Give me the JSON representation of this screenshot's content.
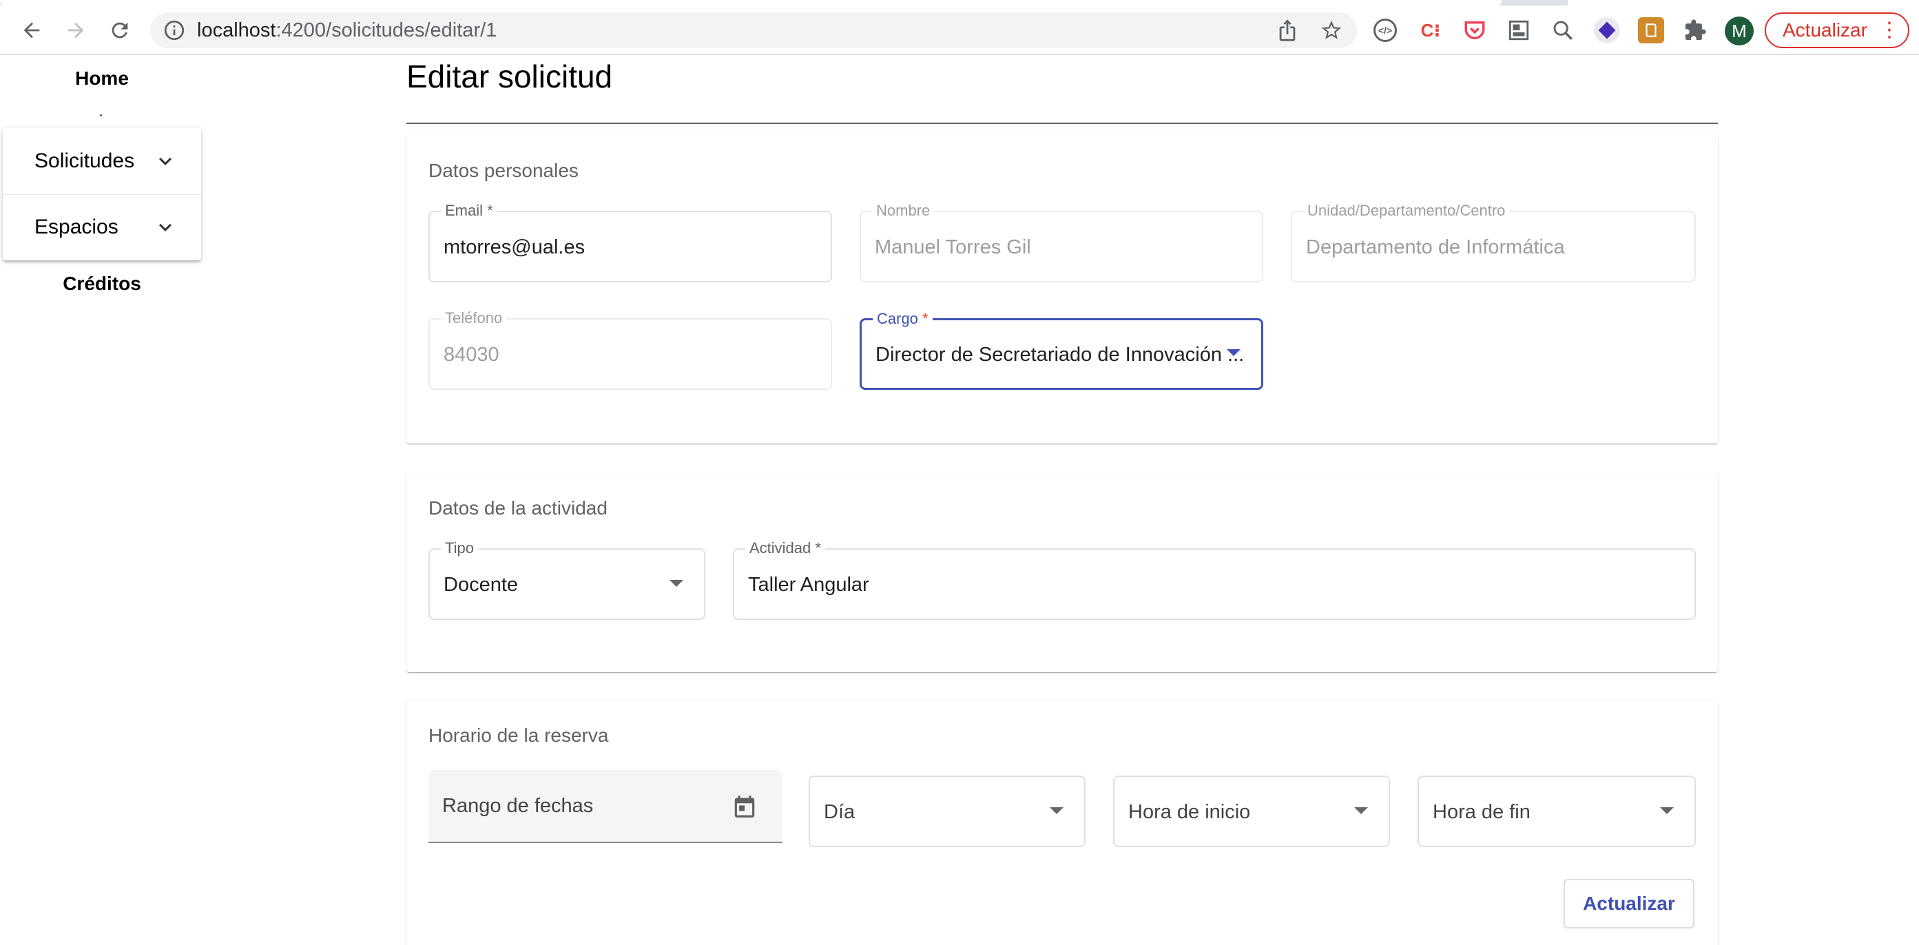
{
  "browser": {
    "url_host": "localhost",
    "url_path": ":4200/solicitudes/editar/1",
    "avatar_letter": "M",
    "update_button_label": "Actualizar",
    "extensions": [
      "code-icon",
      "c-extension-icon",
      "pocket-icon",
      "grid-extension-icon",
      "search-extension-icon",
      "layers-extension-icon",
      "dictionary-extension-icon",
      "puzzle-icon"
    ]
  },
  "sidebar": {
    "home_label": "Home",
    "items": [
      {
        "label": "Solicitudes"
      },
      {
        "label": "Espacios"
      }
    ],
    "credits_label": "Créditos"
  },
  "page": {
    "title": "Editar solicitud"
  },
  "personal": {
    "section_title": "Datos personales",
    "email_label": "Email",
    "email_value": "mtorres@ual.es",
    "nombre_label": "Nombre",
    "nombre_value": "Manuel Torres Gil",
    "unidad_label": "Unidad/Departamento/Centro",
    "unidad_value": "Departamento de Informática",
    "telefono_label": "Teléfono",
    "telefono_value": "84030",
    "cargo_label": "Cargo",
    "cargo_value": "Director de Secretariado de Innovación ..."
  },
  "activity": {
    "section_title": "Datos de la actividad",
    "tipo_label": "Tipo",
    "tipo_value": "Docente",
    "actividad_label": "Actividad",
    "actividad_value": "Taller Angular"
  },
  "schedule": {
    "section_title": "Horario de la reserva",
    "date_range_placeholder": "Rango de fechas",
    "dia_placeholder": "Día",
    "hora_inicio_placeholder": "Hora de inicio",
    "hora_fin_placeholder": "Hora de fin",
    "submit_label": "Actualizar"
  },
  "required_marker": "*",
  "colors": {
    "accent": "#3f51b5",
    "required": "#f44336",
    "browser_update": "#d93025"
  }
}
